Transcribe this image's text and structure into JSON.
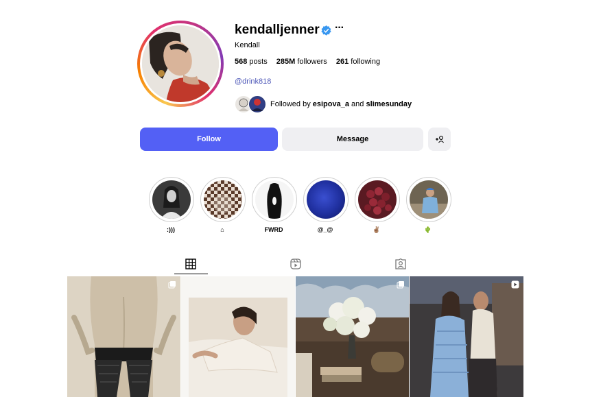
{
  "profile": {
    "username": "kendalljenner",
    "more": "···",
    "full_name": "Kendall",
    "stats": {
      "posts_value": "568",
      "posts_label": "posts",
      "followers_value": "285M",
      "followers_label": "followers",
      "following_value": "261",
      "following_label": "following"
    },
    "bio_link": "@drink818",
    "followed_by_prefix": "Followed by",
    "followed_by_user1": "esipova_a",
    "followed_by_and": "and",
    "followed_by_user2": "slimesunday"
  },
  "actions": {
    "follow_label": "Follow",
    "message_label": "Message",
    "add_user_icon": "add-user-icon"
  },
  "highlights": [
    {
      "label": ":)))"
    },
    {
      "label": "⌂"
    },
    {
      "label": "FWRD"
    },
    {
      "label": "@_@"
    },
    {
      "label": "✌🏽"
    },
    {
      "label": "🌵"
    }
  ],
  "tabs": [
    {
      "icon": "grid-icon",
      "active": true
    },
    {
      "icon": "reels-icon",
      "active": false
    },
    {
      "icon": "tagged-icon",
      "active": false
    }
  ],
  "colors": {
    "follow_button": "#5360f5",
    "secondary_button": "#efeff2",
    "link": "#4e58b8",
    "verified": "#3897f0"
  }
}
